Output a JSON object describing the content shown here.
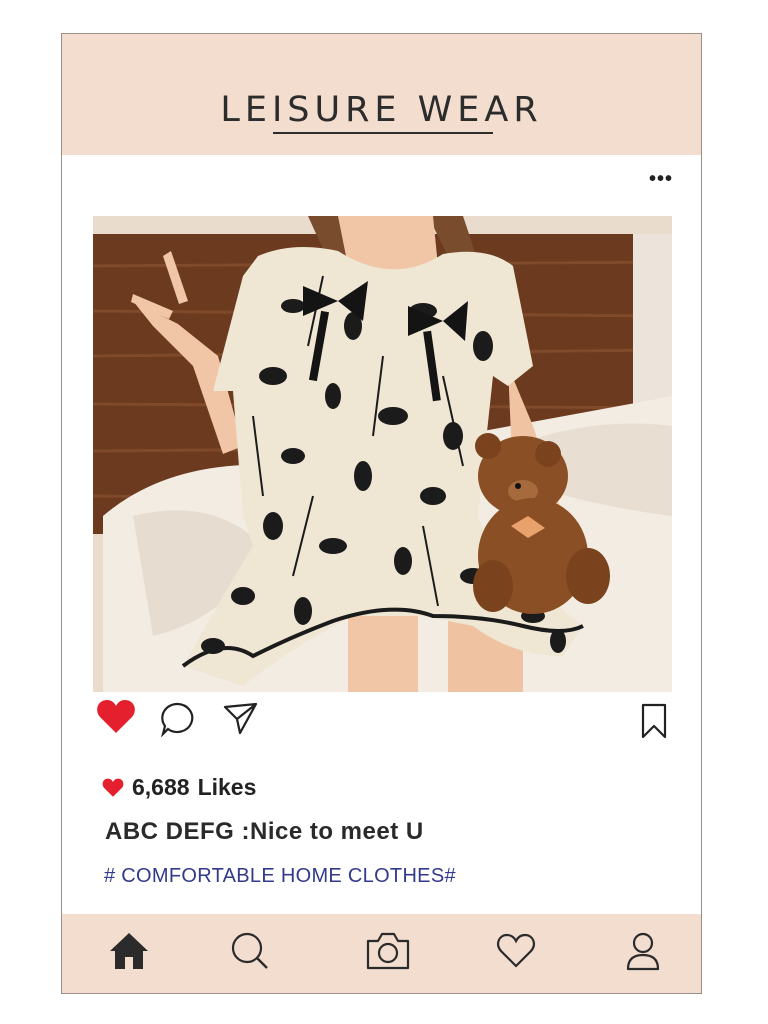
{
  "header": {
    "title": "LEISURE WEAR"
  },
  "post": {
    "more_label": "•••",
    "photo_icon": "photo-of-person-in-floral-dress",
    "likes_count": "6,688",
    "likes_label": "Likes",
    "caption": "ABC DEFG :Nice to meet U",
    "hashtag_open": "#",
    "hashtag_text": "COMFORTABLE HOME CLOTHES",
    "hashtag_close": "#"
  },
  "actions": {
    "like_icon": "heart-filled-icon",
    "comment_icon": "comment-bubble-icon",
    "share_icon": "send-icon",
    "save_icon": "bookmark-icon"
  },
  "nav": {
    "items": [
      {
        "icon": "home-icon"
      },
      {
        "icon": "search-icon"
      },
      {
        "icon": "camera-icon"
      },
      {
        "icon": "heart-outline-icon"
      },
      {
        "icon": "profile-icon"
      }
    ]
  },
  "colors": {
    "header_bg": "#f2ddcf",
    "like_red": "#e4202e",
    "hashtag_blue": "#323a8a",
    "text_dark": "#222222"
  }
}
